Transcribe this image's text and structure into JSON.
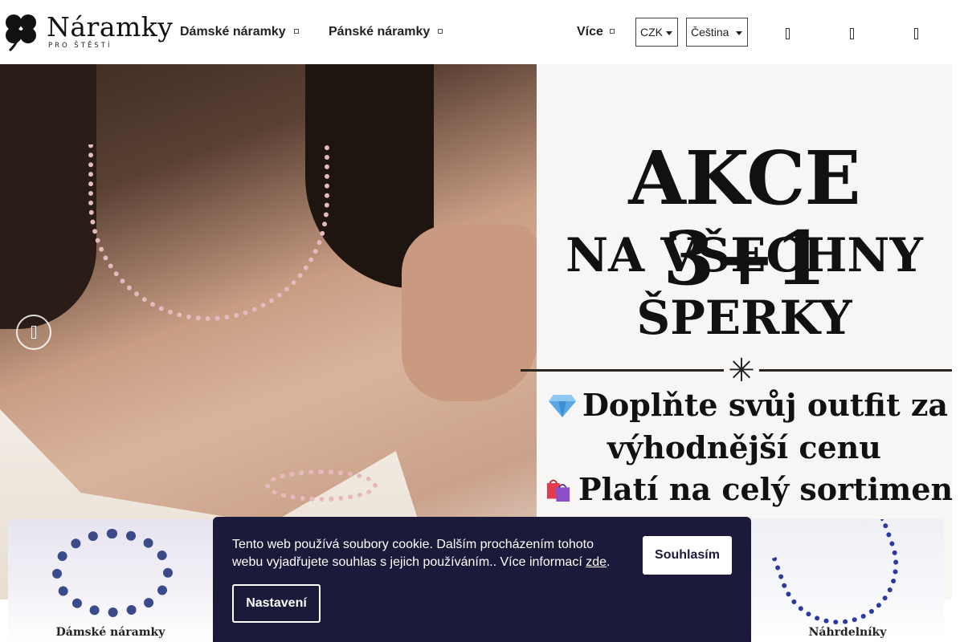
{
  "header": {
    "logo": {
      "word": "Náramky",
      "tagline": "PRO ŠTĚSTÍ",
      "icon": "clover-icon"
    },
    "nav": [
      {
        "label": "Dámské náramky"
      },
      {
        "label": "Pánské náramky"
      }
    ],
    "more_label": "Více",
    "currency": "CZK",
    "language": "Čeština",
    "icons": [
      "search-icon",
      "user-icon",
      "cart-icon"
    ]
  },
  "hero": {
    "title": "AKCE 3+1",
    "subtitle_line1": "NA VŠECHNY",
    "subtitle_line2": "ŠPERKY",
    "line1": "Doplňte svůj outfit za",
    "line2": "výhodnější cenu",
    "line3": "Platí na celý sortiment",
    "icons": [
      "diamond-icon",
      "shopping-bags-icon"
    ]
  },
  "categories": [
    {
      "label": "Dámské náramky"
    },
    {
      "label": "Náhrdelníky"
    }
  ],
  "cookie": {
    "text": "Tento web používá soubory cookie. Dalším procházením tohoto webu vyjadřujete souhlas s jejich používáním.. Více informací ",
    "link": "zde",
    "period": ".",
    "accept": "Souhlasím",
    "settings": "Nastavení"
  },
  "colors": {
    "banner_bg": "#1c1a3a",
    "accent": "#111111"
  }
}
